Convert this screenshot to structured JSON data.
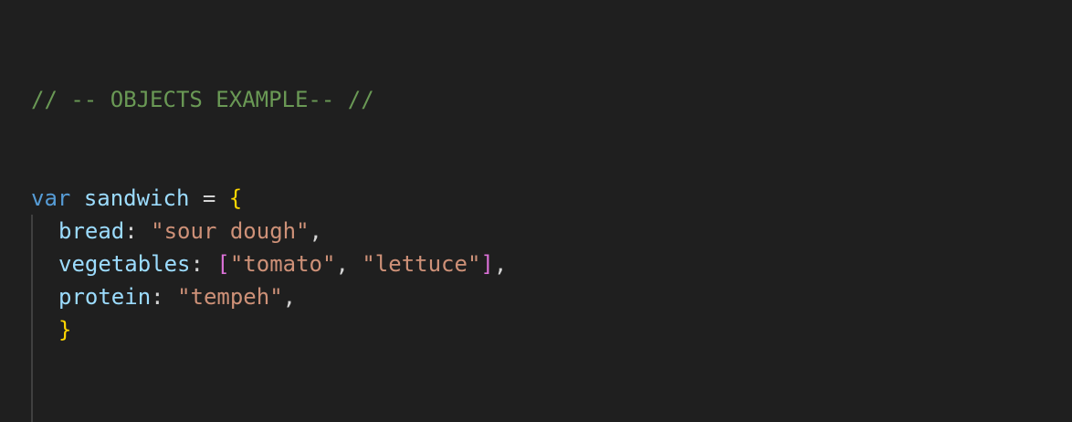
{
  "editor": {
    "lines": {
      "comment": "// -- OBJECTS EXAMPLE-- //",
      "decl": {
        "keyword": "var",
        "name": "sandwich",
        "op": "=",
        "open_brace": "{"
      },
      "bread": {
        "key": "bread",
        "colon": ":",
        "value": "\"sour dough\"",
        "comma": ","
      },
      "vegetables": {
        "key": "vegetables",
        "colon": ":",
        "open_bracket": "[",
        "item1": "\"tomato\"",
        "sep": ",",
        "item2": "\"lettuce\"",
        "close_bracket": "]",
        "comma": ","
      },
      "protein": {
        "key": "protein",
        "colon": ":",
        "value": "\"tempeh\"",
        "comma": ","
      },
      "close": {
        "close_brace": "}"
      }
    },
    "colors": {
      "background": "#1f1f1f",
      "comment": "#6a9955",
      "keyword": "#569cd6",
      "identifier": "#9cdcfe",
      "string": "#ce9178",
      "brace": "#ffd700",
      "bracket": "#da70d6"
    }
  }
}
